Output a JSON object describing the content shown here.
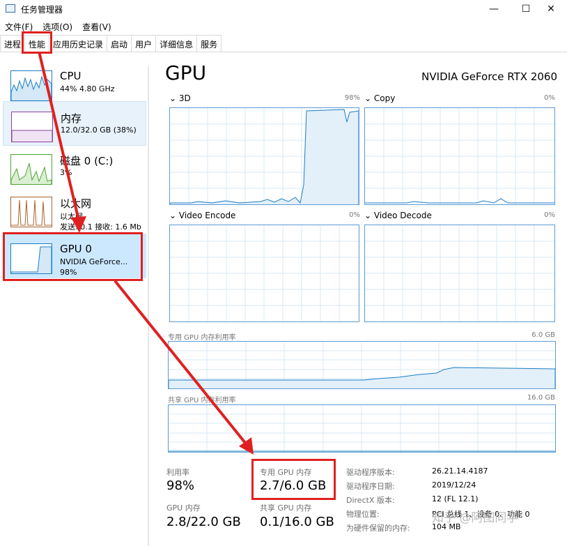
{
  "window": {
    "title": "任务管理器",
    "min": "—",
    "max": "☐",
    "close": "✕"
  },
  "menu": [
    "文件(F)",
    "选项(O)",
    "查看(V)"
  ],
  "tabs": [
    "进程",
    "性能",
    "应用历史记录",
    "启动",
    "用户",
    "详细信息",
    "服务"
  ],
  "devices": {
    "cpu": {
      "name": "CPU",
      "sub": "44%  4.80 GHz",
      "color": "#1a7dc4"
    },
    "mem": {
      "name": "内存",
      "sub": "12.0/32.0 GB (38%)",
      "color": "#8e3fa1"
    },
    "disk": {
      "name": "磁盘 0 (C:)",
      "sub": "3%",
      "color": "#4da533"
    },
    "eth": {
      "name": "以太网",
      "sub": "以太网",
      "sub2": "发送: 0.1  接收: 1.6 Mb",
      "color": "#a8622c"
    },
    "gpu": {
      "name": "GPU 0",
      "sub": "NVIDIA GeForce...",
      "sub2": "98%",
      "color": "#1a7dc4"
    }
  },
  "gpu": {
    "title": "GPU",
    "model": "NVIDIA GeForce RTX 2060",
    "engines": [
      {
        "name": "3D",
        "pct": "98%"
      },
      {
        "name": "Copy",
        "pct": "0%"
      },
      {
        "name": "Video Encode",
        "pct": "0%"
      },
      {
        "name": "Video Decode",
        "pct": "0%"
      }
    ],
    "dedicated_label": "专用 GPU 内存利用率",
    "dedicated_max": "6.0 GB",
    "shared_label": "共享 GPU 内存利用率",
    "shared_max": "16.0 GB"
  },
  "stats": {
    "util_label": "利用率",
    "util_value": "98%",
    "ded_label": "专用 GPU 内存",
    "ded_value": "2.7/6.0 GB",
    "gpumem_label": "GPU 内存",
    "gpumem_value": "2.8/22.0 GB",
    "shared_label": "共享 GPU 内存",
    "shared_value": "0.1/16.0 GB"
  },
  "details": [
    {
      "key": "驱动程序版本:",
      "value": "26.21.14.4187"
    },
    {
      "key": "驱动程序日期:",
      "value": "2019/12/24"
    },
    {
      "key": "DirectX 版本:",
      "value": "12 (FL 12.1)"
    },
    {
      "key": "物理位置:",
      "value": "PCI 总线 1、设备 0、功能 0"
    },
    {
      "key": "为硬件保留的内存:",
      "value": "104 MB"
    }
  ],
  "watermark": "知乎 @阿图同学"
}
